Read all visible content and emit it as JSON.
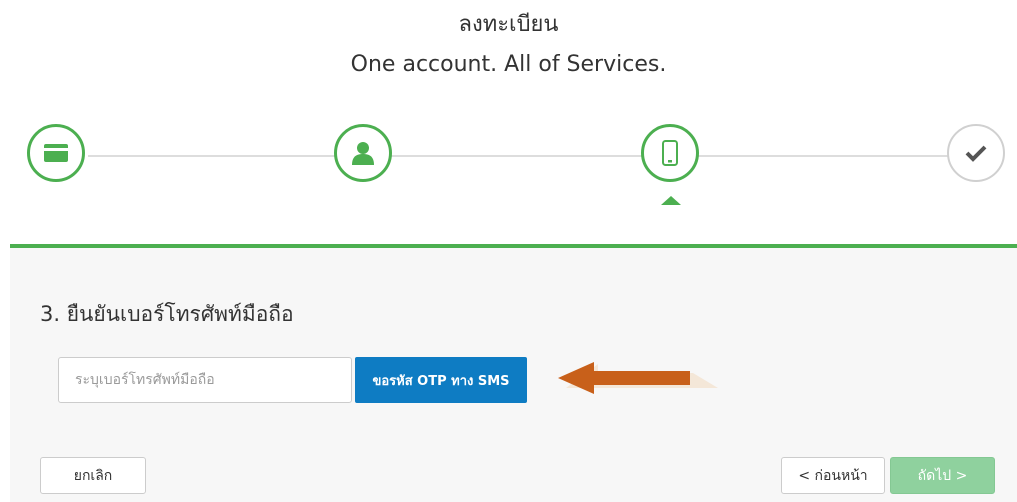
{
  "header": {
    "title": "ลงทะเบียน",
    "subtitle": "One account. All of Services."
  },
  "steps": [
    {
      "icon": "credit-card-icon",
      "status": "complete"
    },
    {
      "icon": "user-icon",
      "status": "complete"
    },
    {
      "icon": "mobile-phone-icon",
      "status": "active"
    },
    {
      "icon": "checkmark-icon",
      "status": "pending"
    }
  ],
  "form": {
    "heading": "3. ยืนยันเบอร์โทรศัพท์มือถือ",
    "phone_value": "",
    "phone_placeholder": "ระบุเบอร์โทรศัพท์มือถือ",
    "otp_button_label": "ขอรหัส OTP ทาง SMS"
  },
  "footer": {
    "cancel_label": "ยกเลิก",
    "prev_label": "< ก่อนหน้า",
    "next_label": "ถัดไป >"
  },
  "colors": {
    "accent": "#4caf50",
    "primary_button": "#0e7cc3",
    "next_button_disabled": "#8fd19e",
    "arrow": "#c8601a"
  }
}
